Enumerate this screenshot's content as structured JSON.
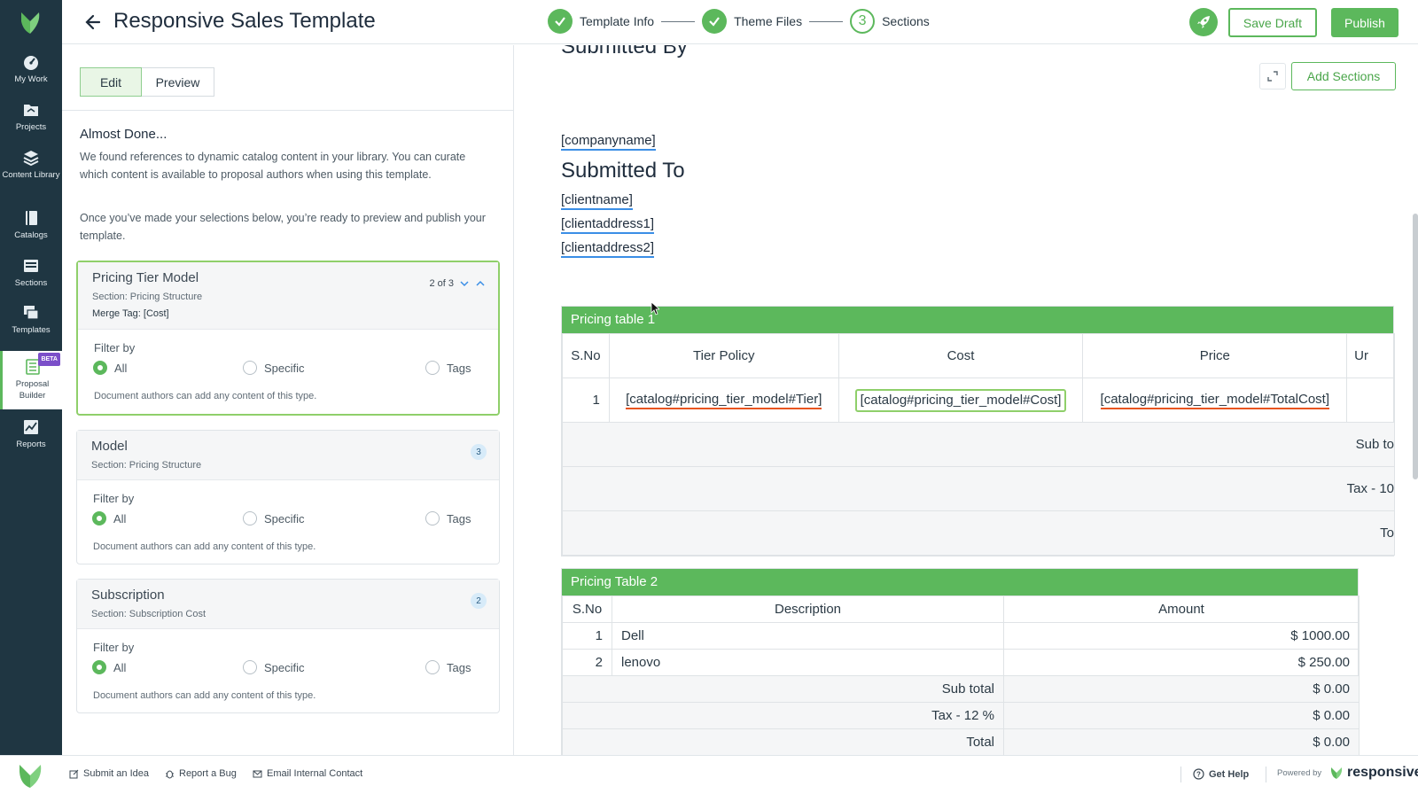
{
  "header": {
    "title": "Responsive Sales Template",
    "steps": [
      {
        "label": "Template Info",
        "state": "done"
      },
      {
        "label": "Theme Files",
        "state": "done"
      },
      {
        "label": "Sections",
        "number": "3",
        "state": "current"
      }
    ],
    "save_draft": "Save Draft",
    "publish": "Publish"
  },
  "nav": {
    "items": [
      {
        "label": "My Work",
        "icon": "speedometer-icon"
      },
      {
        "label": "Projects",
        "icon": "folder-icon"
      },
      {
        "label": "Content Library",
        "icon": "stack-icon"
      },
      {
        "label": "Catalogs",
        "icon": "book-icon"
      },
      {
        "label": "Sections",
        "icon": "sections-icon"
      },
      {
        "label": "Templates",
        "icon": "templates-icon"
      },
      {
        "label": "Proposal Builder",
        "icon": "document-list-icon",
        "badge": "BETA",
        "active": true
      },
      {
        "label": "Reports",
        "icon": "chart-icon"
      }
    ]
  },
  "panel": {
    "edit_tab": "Edit",
    "preview_tab": "Preview",
    "heading": "Almost Done...",
    "para1": "We found references to dynamic catalog content in your library. You can curate which content is available to proposal authors when using this template.",
    "para2": "Once you’ve made your selections below, you’re ready to preview and publish your template.",
    "cards": [
      {
        "title": "Pricing Tier Model",
        "section": "Section: Pricing Structure",
        "merge_tag": "Merge Tag: [Cost]",
        "pager": "2 of 3",
        "filter_label": "Filter by",
        "options": [
          "All",
          "Specific",
          "Tags"
        ],
        "selected": "All",
        "note": "Document authors can add any content of this type."
      },
      {
        "title": "Model",
        "section": "Section: Pricing Structure",
        "count": "3",
        "filter_label": "Filter by",
        "options": [
          "All",
          "Specific",
          "Tags"
        ],
        "selected": "All",
        "note": "Document authors can add any content of this type."
      },
      {
        "title": "Subscription",
        "section": "Section: Subscription Cost",
        "count": "2",
        "filter_label": "Filter by",
        "options": [
          "All",
          "Specific",
          "Tags"
        ],
        "selected": "All",
        "note": "Document authors can add any content of this type."
      }
    ]
  },
  "preview": {
    "add_sections": "Add Sections",
    "submitted_by_cut": "Submitted By",
    "company_tag": "[companyname]",
    "submitted_to": "Submitted To",
    "client_tags": [
      "[clientname]",
      "[clientaddress1]",
      "[clientaddress2]"
    ],
    "table1": {
      "title": "Pricing table 1",
      "headers": [
        "S.No",
        "Tier Policy",
        "Cost",
        "Price",
        "Ur"
      ],
      "row": [
        "1",
        "[catalog#pricing_tier_model#Tier]",
        "[catalog#pricing_tier_model#Cost]",
        "[catalog#pricing_tier_model#TotalCost]"
      ],
      "summary": [
        "Sub to",
        "Tax - 10",
        "To"
      ]
    },
    "table2": {
      "title": "Pricing Table 2",
      "headers": [
        "S.No",
        "Description",
        "Amount"
      ],
      "rows": [
        {
          "no": "1",
          "desc": "Dell",
          "amount": "$ 1000.00"
        },
        {
          "no": "2",
          "desc": "lenovo",
          "amount": "$ 250.00"
        }
      ],
      "summary": [
        {
          "label": "Sub total",
          "value": "$ 0.00"
        },
        {
          "label": "Tax - 12 %",
          "value": "$ 0.00"
        },
        {
          "label": "Total",
          "value": "$ 0.00"
        }
      ]
    }
  },
  "footer": {
    "links": [
      "Submit an Idea",
      "Report a Bug",
      "Email Internal Contact"
    ],
    "help": "Get Help",
    "powered": "Powered by",
    "brand": "responsive"
  },
  "colors": {
    "accent": "#5cb85c",
    "nav_bg": "#1f3642",
    "tag_underline": "#3a8ee6",
    "catalog_underline": "#e8541f"
  }
}
